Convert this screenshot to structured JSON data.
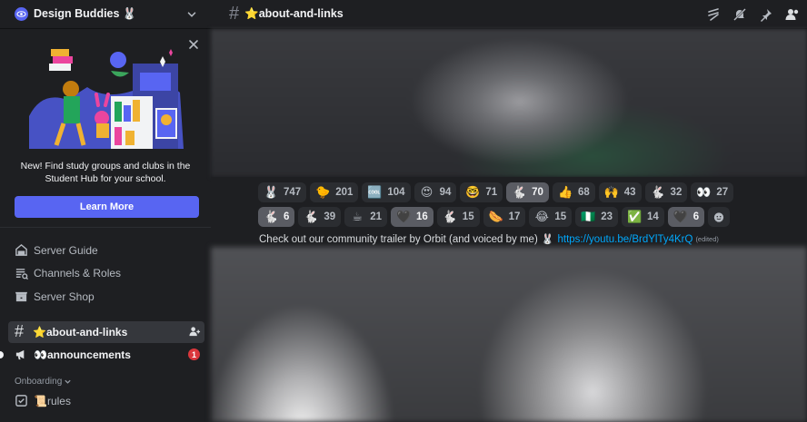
{
  "server": {
    "name": "Design Buddies 🐰"
  },
  "promo": {
    "text": "New! Find study groups and clubs in the Student Hub for your school.",
    "button": "Learn More"
  },
  "nav": [
    {
      "label": "Server Guide",
      "icon": "server-guide-icon"
    },
    {
      "label": "Channels & Roles",
      "icon": "channels-roles-icon"
    },
    {
      "label": "Server Shop",
      "icon": "shop-icon"
    }
  ],
  "channels": {
    "active": "⭐about-and-links",
    "announcements": "👀announcements",
    "announcements_badge": "1",
    "category": "Onboarding",
    "rules": "📜rules"
  },
  "topbar": {
    "channel": "⭐about-and-links"
  },
  "reactions": {
    "row1": [
      {
        "emoji": "🐰",
        "count": "747",
        "on": false
      },
      {
        "emoji": "🐤",
        "count": "201",
        "on": false
      },
      {
        "emoji": "🆒",
        "count": "104",
        "on": false
      },
      {
        "emoji": "😍",
        "count": "94",
        "on": false
      },
      {
        "emoji": "🤓",
        "count": "71",
        "on": false
      },
      {
        "emoji": "🐇",
        "count": "70",
        "on": true
      },
      {
        "emoji": "👍",
        "count": "68",
        "on": false
      },
      {
        "emoji": "🙌",
        "count": "43",
        "on": false
      },
      {
        "emoji": "🐇",
        "count": "32",
        "on": false
      },
      {
        "emoji": "👀",
        "count": "27",
        "on": false
      }
    ],
    "row2": [
      {
        "emoji": "🐇",
        "count": "6",
        "on": true
      },
      {
        "emoji": "🐇",
        "count": "39",
        "on": false
      },
      {
        "emoji": "☕",
        "count": "21",
        "on": false
      },
      {
        "emoji": "🖤",
        "count": "16",
        "on": true
      },
      {
        "emoji": "🐇",
        "count": "15",
        "on": false
      },
      {
        "emoji": "🌭",
        "count": "17",
        "on": false
      },
      {
        "emoji": "😂",
        "count": "15",
        "on": false
      },
      {
        "emoji": "🇳🇬",
        "count": "23",
        "on": false
      },
      {
        "emoji": "✅",
        "count": "14",
        "on": false
      },
      {
        "emoji": "🖤",
        "count": "6",
        "on": true
      }
    ]
  },
  "message": {
    "text": "Check out our community trailer by Orbit  (and voiced by me)",
    "bunny": "🐰",
    "link": "https://youtu.be/BrdYlTy4KrQ",
    "edited": "(edited)"
  }
}
